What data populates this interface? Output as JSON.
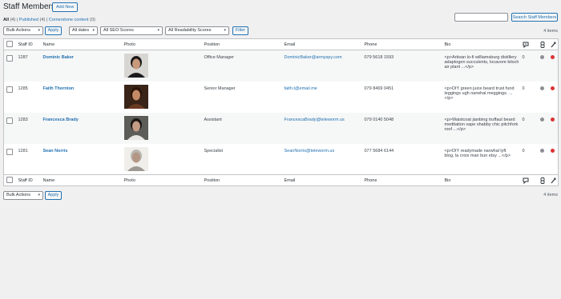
{
  "header": {
    "title": "Staff Members",
    "add_new": "Add New"
  },
  "views": {
    "all": "All",
    "all_count": "(4)",
    "published": "Published",
    "published_count": "(4)",
    "cornerstone": "Cornerstone content",
    "cornerstone_count": "(0)",
    "sep": "|"
  },
  "search": {
    "button": "Search Staff Members",
    "value": ""
  },
  "filters": {
    "bulk_actions": "Bulk Actions",
    "apply": "Apply",
    "all_dates": "All dates",
    "seo": "All SEO Scores",
    "readability": "All Readability Scores",
    "filter": "Filter"
  },
  "items_count": "4 items",
  "columns": {
    "id": "Staff ID",
    "name": "Name",
    "photo": "Photo",
    "position": "Position",
    "email": "Email",
    "phone": "Phone",
    "bio": "Bio"
  },
  "icons": {
    "comments": "comment-count-icon",
    "links": "link-count-icon",
    "seo": "seo-score-icon"
  },
  "colors": {
    "accent": "#2271b1",
    "gray_dot": "#8c8f94",
    "red_dot": "#dc3232"
  },
  "rows": [
    {
      "id": "1287",
      "name": "Dominic Baker",
      "position": "Office Manager",
      "email": "DominicBaker@armyspy.com",
      "phone": "079 5618 1593",
      "bio1": "<p>Artisan lo-fi williamsburg distillery",
      "bio2": "adaptogen succulents, locavore kitsch",
      "bio3": "air plant ...</p>",
      "links": "0",
      "seo": "red"
    },
    {
      "id": "1285",
      "name": "Faith Thornton",
      "position": "Senior Manager",
      "email": "faith.t@email.me",
      "phone": "079 8469 0451",
      "bio1": "<p>DIY green juice beard trust fund",
      "bio2": "leggings ugh narwhal meggings. ...",
      "bio3": "</p>",
      "links": "0",
      "seo": "red"
    },
    {
      "id": "1283",
      "name": "Francesca Brady",
      "position": "Assistant",
      "email": "FrancescaBrady@teleworm.us",
      "phone": "079 0140 5048",
      "bio1": "<p>Waistcoat jianbing truffaut beard",
      "bio2": "meditation vape shabby chic pitchfork",
      "bio3": "roof ...</p>",
      "links": "0",
      "seo": "red"
    },
    {
      "id": "1281",
      "name": "Sean Norris",
      "position": "Specialist",
      "email": "SeanNorris@teleworm.us",
      "phone": "077 5684 6144",
      "bio1": "<p>DIY readymade narwhal lyft",
      "bio2": "blog, la croix man bun etsy ...</p>",
      "bio3": "",
      "links": "0",
      "seo": "red"
    }
  ]
}
